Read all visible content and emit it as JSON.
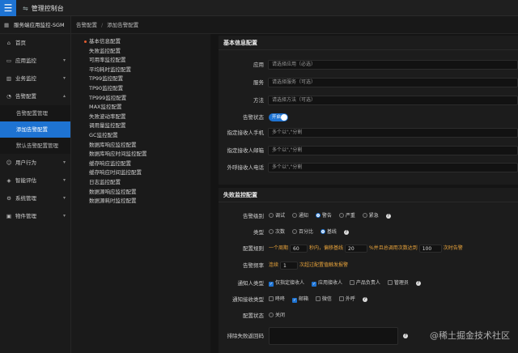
{
  "header": {
    "title": "管理控制台"
  },
  "sidebar": {
    "project": "服务端应用监控-SGM",
    "items": [
      {
        "label": "首页"
      },
      {
        "label": "应用监控"
      },
      {
        "label": "业务监控"
      },
      {
        "label": "告警配置"
      }
    ],
    "subitems": [
      {
        "label": "告警配置管理"
      },
      {
        "label": "添加告警配置"
      },
      {
        "label": "默认告警配置管理"
      }
    ],
    "items2": [
      {
        "label": "用户行为"
      },
      {
        "label": "智能评估"
      },
      {
        "label": "系统管理"
      },
      {
        "label": "物件管理"
      }
    ]
  },
  "breadcrumb": {
    "parent": "告警配置",
    "sep": "/",
    "current": "添加告警配置"
  },
  "anchors": [
    "基本信息配置",
    "失败监控配置",
    "可用率监控配置",
    "平均耗时监控配置",
    "TP99监控配置",
    "TP90监控配置",
    "TP999监控配置",
    "MAX监控配置",
    "失败波动率配置",
    "调用量监控配置",
    "GC监控配置",
    "数据库响应监控配置",
    "数据库响应时间监控配置",
    "缓存响应监控配置",
    "缓存响应时间监控配置",
    "日志监控配置",
    "数据源响应监控配置",
    "数据源耗时监控配置"
  ],
  "basic": {
    "title": "基本信息配置",
    "app_label": "应用",
    "app_placeholder": "请选择应用（必选）",
    "service_label": "服务",
    "service_placeholder": "请选择服务（可选）",
    "method_label": "方法",
    "method_placeholder": "请选择方法（可选）",
    "status_label": "告警状态",
    "status_value": "开启",
    "phone_label": "指定接收人手机",
    "phone_placeholder": "多个以\",\"分割",
    "email_label": "指定接收人邮箱",
    "email_placeholder": "多个以\",\"分割",
    "ext_label": "外呼接收人电话",
    "ext_placeholder": "多个以\",\"分割"
  },
  "failure": {
    "title": "失败监控配置",
    "level_label": "告警级别",
    "levels": [
      "调试",
      "通知",
      "警告",
      "严重",
      "紧急"
    ],
    "type_label": "类型",
    "types": [
      "次数",
      "百分比",
      "基线"
    ],
    "rule_label": "配置规则",
    "rule_prefix": "一个周期",
    "rule_v1": "60",
    "rule_mid1": "秒内，偏移基线",
    "rule_v2": "20",
    "rule_mid2": "%并且总调用次数达到",
    "rule_v3": "100",
    "rule_suffix": "次时告警",
    "freq_label": "告警频率",
    "freq_prefix": "连续",
    "freq_v": "1",
    "freq_suffix": "次超过配置值触发报警",
    "notify_label": "通知人类型",
    "notify_opts": [
      "仅指定接收人",
      "应用接收人",
      "产品负责人",
      "管理员"
    ],
    "method_label": "通知接收类型",
    "method_opts": [
      "咚咚",
      "邮箱",
      "微信",
      "外呼"
    ],
    "cfgstatus_label": "配置状态",
    "cfgstatus_value": "关闭",
    "exclude_label": "排除失败返回码"
  },
  "watermark": "@稀土掘金技术社区"
}
